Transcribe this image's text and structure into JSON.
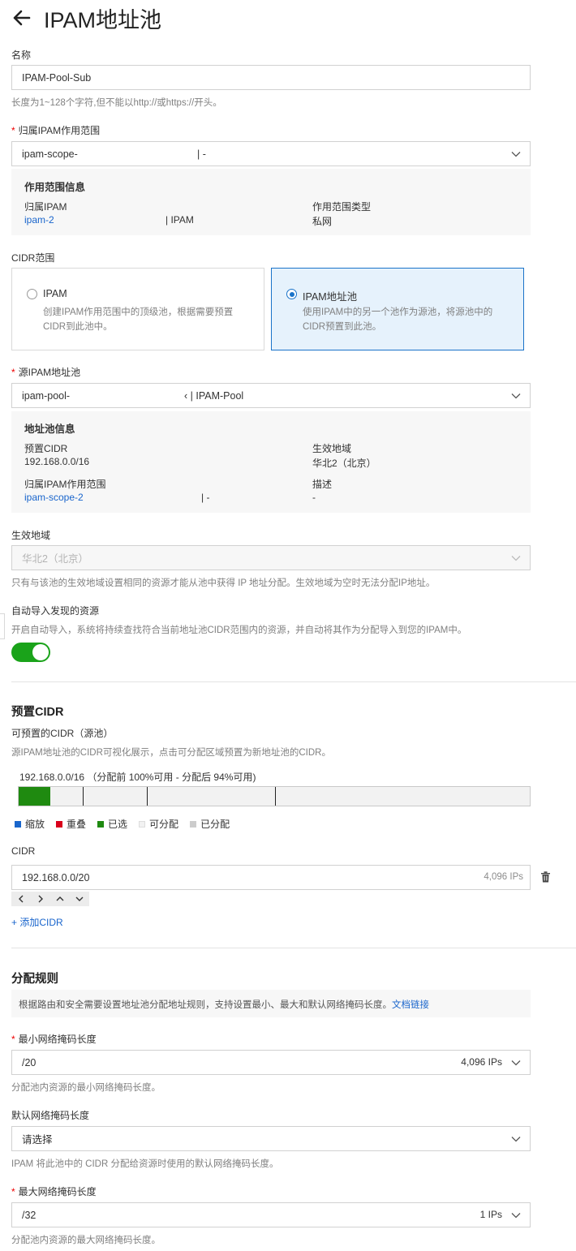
{
  "header": {
    "title": "IPAM地址池"
  },
  "name_field": {
    "label": "名称",
    "value": "IPAM-Pool-Sub",
    "help": "长度为1~128个字符,但不能以http://或https://开头。"
  },
  "scope_field": {
    "required_mark": "*",
    "label": "归属IPAM作用范围",
    "value_prefix": "ipam-scope-",
    "value_suffix": "| -",
    "info": {
      "title": "作用范围信息",
      "ipam_label": "归属IPAM",
      "ipam_value_prefix": "ipam-2",
      "ipam_value_suffix": "|  IPAM",
      "type_label": "作用范围类型",
      "type_value": "私网"
    }
  },
  "cidr_scope": {
    "label": "CIDR范围",
    "options": [
      {
        "title": "IPAM",
        "desc": "创建IPAM作用范围中的顶级池，根据需要预置CIDR到此池中。",
        "selected": false
      },
      {
        "title": "IPAM地址池",
        "desc": "使用IPAM中的另一个池作为源池，将源池中的CIDR预置到此池。",
        "selected": true
      }
    ]
  },
  "source_pool": {
    "required_mark": "*",
    "label": "源IPAM地址池",
    "value_prefix": "ipam-pool-",
    "value_suffix": "‹ | IPAM-Pool",
    "info": {
      "title": "地址池信息",
      "cidr_label": "预置CIDR",
      "cidr_value": "192.168.0.0/16",
      "region_label": "生效地域",
      "region_value": "华北2（北京）",
      "scope_label": "归属IPAM作用范围",
      "scope_value_prefix": "ipam-scope-2",
      "scope_value_suffix": "|  -",
      "desc_label": "描述",
      "desc_value": "-"
    }
  },
  "region_field": {
    "label": "生效地域",
    "value": "华北2（北京）",
    "help": "只有与该池的生效地域设置相同的资源才能从池中获得 IP 地址分配。生效地域为空时无法分配IP地址。"
  },
  "auto_import": {
    "label": "自动导入发现的资源",
    "help": "开启自动导入，系统将持续查找符合当前地址池CIDR范围内的资源，并自动将其作为分配导入到您的IPAM中。",
    "enabled": true
  },
  "preset_cidr": {
    "section_title": "预置CIDR",
    "sub_title": "可预置的CIDR（源池）",
    "help": "源IPAM地址池的CIDR可视化展示，点击可分配区域预置为新地址池的CIDR。",
    "bar_label": "192.168.0.0/16  （分配前 100%可用 - 分配后 94%可用)",
    "allocated_fraction": 0.0625,
    "legend": [
      {
        "label": "缩放",
        "color": "#1966cc"
      },
      {
        "label": "重叠",
        "color": "#d9001b"
      },
      {
        "label": "已选",
        "color": "#1f8a10"
      },
      {
        "label": "可分配",
        "color": "#f2f2f2"
      },
      {
        "label": "已分配",
        "color": "#cccccc"
      }
    ],
    "cidr_label": "CIDR",
    "cidr_value": "192.168.0.0/20",
    "cidr_ips": "4,096 IPs",
    "add_label": "+ 添加CIDR"
  },
  "alloc_rules": {
    "section_title": "分配规则",
    "notice": "根据路由和安全需要设置地址池分配地址规则，支持设置最小、最大和默认网络掩码长度。",
    "notice_link": "文档链接",
    "min_mask": {
      "required_mark": "*",
      "label": "最小网络掩码长度",
      "value": "/20",
      "ips": "4,096 IPs",
      "help": "分配池内资源的最小网络掩码长度。"
    },
    "default_mask": {
      "label": "默认网络掩码长度",
      "placeholder": "请选择",
      "help": "IPAM 将此池中的 CIDR 分配给资源时使用的默认网络掩码长度。"
    },
    "max_mask": {
      "required_mark": "*",
      "label": "最大网络掩码长度",
      "value": "/32",
      "ips": "1 IPs",
      "help": "分配池内资源的最大网络掩码长度。"
    }
  }
}
